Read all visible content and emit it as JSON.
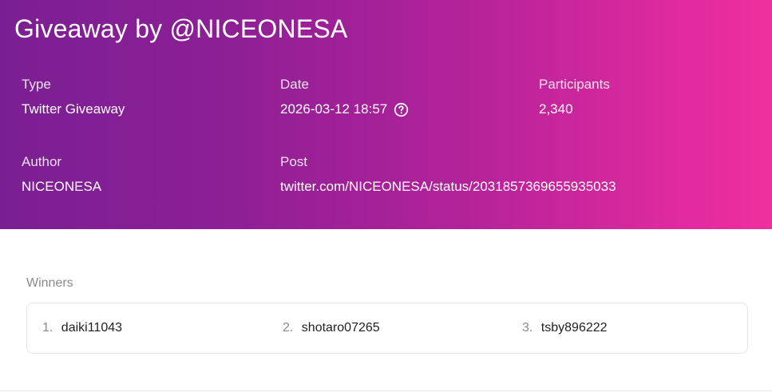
{
  "header": {
    "title": "Giveaway by @NICEONESA",
    "gradient_start": "#7a1f93",
    "gradient_end": "#ef2f9f"
  },
  "details": {
    "type": {
      "label": "Type",
      "value": "Twitter Giveaway"
    },
    "date": {
      "label": "Date",
      "value": "2026-03-12 18:57",
      "icon": "help-icon"
    },
    "participants": {
      "label": "Participants",
      "value": "2,340"
    },
    "author": {
      "label": "Author",
      "value": "NICEONESA"
    },
    "post": {
      "label": "Post",
      "value": "twitter.com/NICEONESA/status/2031857369655935033"
    }
  },
  "winners": {
    "label": "Winners",
    "items": [
      {
        "number": "1.",
        "name": "daiki11043"
      },
      {
        "number": "2.",
        "name": "shotaro07265"
      },
      {
        "number": "3.",
        "name": "tsby896222"
      }
    ]
  }
}
